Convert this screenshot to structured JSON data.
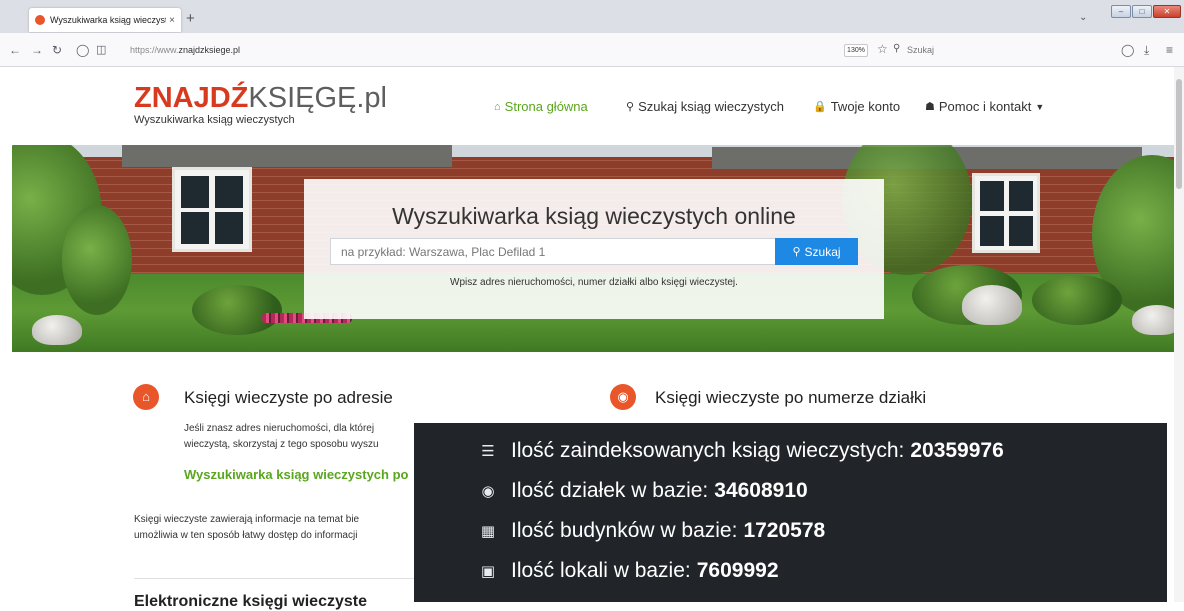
{
  "browser": {
    "tab_title": "Wyszukiwarka ksiąg wieczystych",
    "tab_close": "×",
    "new_tab": "+",
    "url_prefix": "https://www.",
    "url_domain": "znajdzksiege.pl",
    "zoom": "130%",
    "search_placeholder": "Szukaj"
  },
  "site": {
    "logo_red": "ZNAJDŹ",
    "logo_gray": "KSIĘGĘ.pl",
    "tagline": "Wyszukiwarka ksiąg wieczystych",
    "nav": [
      {
        "label": "Strona główna"
      },
      {
        "label": "Szukaj ksiąg wieczystych"
      },
      {
        "label": "Twoje konto"
      },
      {
        "label": "Pomoc i kontakt"
      }
    ]
  },
  "hero": {
    "title": "Wyszukiwarka ksiąg wieczystych online",
    "search_placeholder": "na przykład: Warszawa, Plac Defilad 1",
    "search_button": "Szukaj",
    "hint": "Wpisz adres nieruchomości, numer działki albo księgi wieczystej."
  },
  "sections": {
    "address": {
      "title": "Księgi wieczyste po adresie",
      "text_line1": "Jeśli znasz adres nieruchomości, dla której",
      "text_line2": "wieczystą, skorzystaj z tego sposobu wyszu",
      "link": "Wyszukiwarka ksiąg wieczystych po"
    },
    "parcel": {
      "title": "Księgi wieczyste po numerze działki"
    },
    "info_line1": "Księgi wieczyste zawierają informacje na temat bie",
    "info_line2": "umożliwia w ten sposób łatwy dostęp do informacji",
    "next_heading": "Elektroniczne księgi wieczyste"
  },
  "stats": [
    {
      "label": "Ilość zaindeksowanych ksiąg wieczystych:",
      "value": "20359976",
      "icon": "database-icon"
    },
    {
      "label": "Ilość działek w bazie:",
      "value": "34608910",
      "icon": "map-marker-icon"
    },
    {
      "label": "Ilość budynków w bazie:",
      "value": "1720578",
      "icon": "building-icon"
    },
    {
      "label": "Ilość lokali w bazie:",
      "value": "7609992",
      "icon": "mailbox-icon"
    }
  ],
  "colors": {
    "brand_red": "#d73a1e",
    "link_green": "#5aa61f",
    "search_blue": "#1e88e5",
    "stats_bg": "#212529"
  }
}
